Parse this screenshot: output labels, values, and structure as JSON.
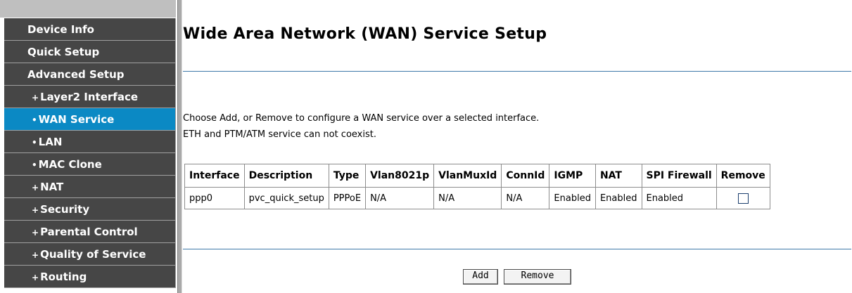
{
  "sidebar": {
    "items": [
      {
        "label": "Device Info",
        "bullet": "",
        "active": false
      },
      {
        "label": "Quick Setup",
        "bullet": "",
        "active": false
      },
      {
        "label": "Advanced Setup",
        "bullet": "",
        "active": false
      },
      {
        "label": "Layer2 Interface",
        "bullet": "+",
        "active": false
      },
      {
        "label": "WAN Service",
        "bullet": "•",
        "active": true
      },
      {
        "label": "LAN",
        "bullet": "•",
        "active": false
      },
      {
        "label": "MAC Clone",
        "bullet": "•",
        "active": false
      },
      {
        "label": "NAT",
        "bullet": "+",
        "active": false
      },
      {
        "label": "Security",
        "bullet": "+",
        "active": false
      },
      {
        "label": "Parental Control",
        "bullet": "+",
        "active": false
      },
      {
        "label": "Quality of Service",
        "bullet": "+",
        "active": false
      },
      {
        "label": "Routing",
        "bullet": "+",
        "active": false
      }
    ]
  },
  "main": {
    "title": "Wide Area Network (WAN) Service Setup",
    "description_1": "Choose Add, or Remove to configure a WAN service over a selected interface.",
    "description_2": "ETH and PTM/ATM service can not coexist.",
    "table": {
      "headers": [
        "Interface",
        "Description",
        "Type",
        "Vlan8021p",
        "VlanMuxId",
        "ConnId",
        "IGMP",
        "NAT",
        "SPI Firewall",
        "Remove"
      ],
      "rows": [
        [
          "ppp0",
          "pvc_quick_setup",
          "PPPoE",
          "N/A",
          "N/A",
          "N/A",
          "Enabled",
          "Enabled",
          "Enabled",
          ""
        ]
      ]
    },
    "buttons": {
      "add": "Add",
      "remove": "Remove"
    }
  },
  "colors": {
    "nav_bg": "#464646",
    "nav_active": "#0b89c4",
    "rule": "#3d79a8"
  }
}
